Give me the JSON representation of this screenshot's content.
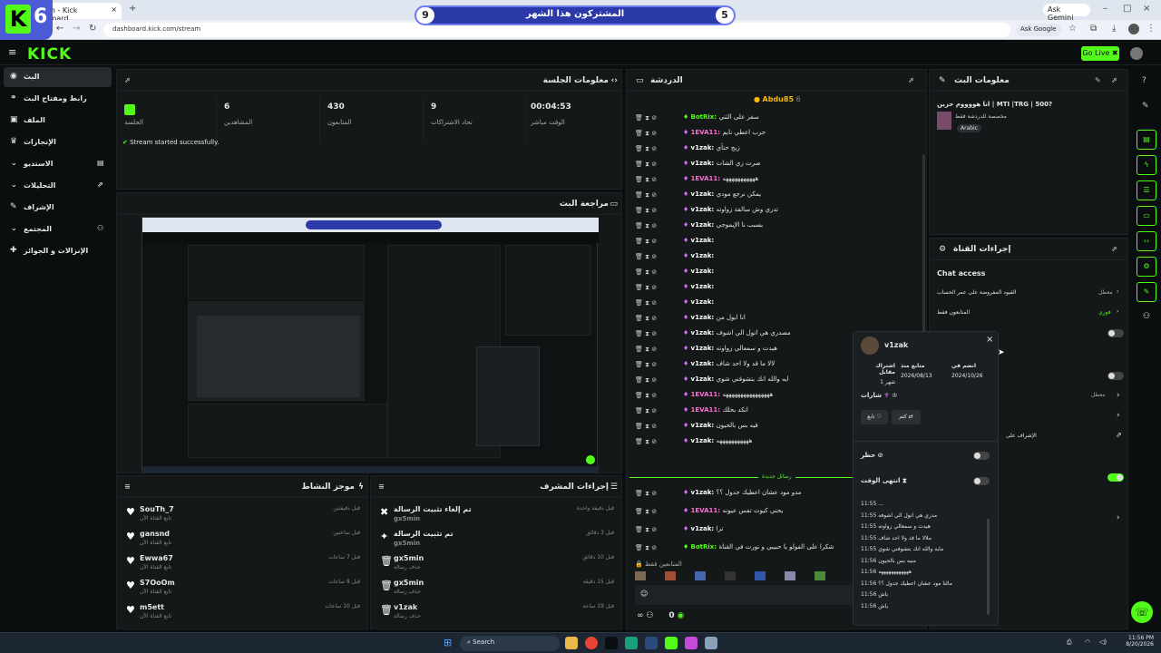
{
  "browser": {
    "tab_title": "Stream - Kick Dashboard",
    "url": "dashboard.kick.com/stream",
    "ask_gemini": "Ask Gemini",
    "ask_google": "Ask Google"
  },
  "overlay": {
    "badge_number": "6",
    "goal_title": "المشتركون هذا الشهر",
    "goal_left": "9",
    "goal_right": "5"
  },
  "header": {
    "logo": "KICK",
    "go_live": "Go Live"
  },
  "sidebar": {
    "items": [
      {
        "label": "البث"
      },
      {
        "label": "رابط ومفتاح البث"
      },
      {
        "label": "الملف"
      },
      {
        "label": "الإنجازات"
      },
      {
        "label": "الاستديو"
      },
      {
        "label": "التحليلات"
      },
      {
        "label": "الإشراف"
      },
      {
        "label": "المجتمع"
      },
      {
        "label": "الإنزالات و الجوائز"
      }
    ]
  },
  "session": {
    "title": "معلومات الجلسة",
    "live_label": "الجلسة",
    "stats": [
      {
        "value": "00:04:53",
        "label": "الوقت مباشر"
      },
      {
        "value": "9",
        "label": "تحاد الاشتراكات"
      },
      {
        "value": "430",
        "label": "المتابعون"
      },
      {
        "value": "6",
        "label": "المشاهدين"
      }
    ],
    "status": "Stream started successfully."
  },
  "preview": {
    "title": "مراجعة البث"
  },
  "activity": {
    "title": "موجز النشاط",
    "rows": [
      {
        "name": "SouTh_7",
        "sub": "تابع القناة الآن",
        "time": "قبل دقيقتين"
      },
      {
        "name": "gansnd",
        "sub": "تابع القناة الآن",
        "time": "قبل ساعتين"
      },
      {
        "name": "Ewwa67",
        "sub": "تابع القناة الآن",
        "time": "قبل 7 ساعات"
      },
      {
        "name": "S7OoOm",
        "sub": "تابع القناة الآن",
        "time": "قبل 8 ساعات"
      },
      {
        "name": "m5ett",
        "sub": "تابع القناة الآن",
        "time": "قبل 10 ساعات"
      }
    ]
  },
  "modactions": {
    "title": "إجراءات المشرف",
    "rows": [
      {
        "action": "تم إلغاء تثبيت الرسالة",
        "by": "gx5min",
        "time": "قبل دقيقة واحدة"
      },
      {
        "action": "تم تثبيت الرسالة",
        "by": "gx5min",
        "time": "قبل 3 دقائق"
      },
      {
        "action": "gx5min",
        "by": "حذف رسالة",
        "time": "قبل 10 دقائق"
      },
      {
        "action": "gx5min",
        "by": "حذف رسالة",
        "time": "قبل 15 دقيقة"
      },
      {
        "action": "v1zak",
        "by": "حذف رسالة",
        "time": "قبل 19 ساعة"
      }
    ]
  },
  "chat": {
    "title": "الدردشة",
    "pinned_user": "Abdu85",
    "pinned_count": "6",
    "lines": [
      {
        "user": "BotRix:",
        "text": "سفر على الثني",
        "color": "#53fc18"
      },
      {
        "user": "1EVA11:",
        "text": "جرب اعطي نايم",
        "color": "#ff6fd1"
      },
      {
        "user": "v1zak:",
        "text": "زيج حتأي",
        "color": "#ffffff"
      },
      {
        "user": "v1zak:",
        "text": "صرت زي الشات",
        "color": "#ffffff"
      },
      {
        "user": "1EVA11:",
        "text": "هههههههههههه",
        "color": "#ff6fd1"
      },
      {
        "user": "v1zak:",
        "text": "يمكن نرجع مودي",
        "color": "#ffffff"
      },
      {
        "user": "v1zak:",
        "text": "تدري وش سالفة زواوته",
        "color": "#ffffff"
      },
      {
        "user": "v1zak:",
        "text": "بسبب نا الإيموجي",
        "color": "#ffffff"
      },
      {
        "user": "v1zak:",
        "text": "",
        "color": "#ffffff"
      },
      {
        "user": "v1zak:",
        "text": "",
        "color": "#ffffff"
      },
      {
        "user": "v1zak:",
        "text": "",
        "color": "#ffffff"
      },
      {
        "user": "v1zak:",
        "text": "",
        "color": "#ffffff"
      },
      {
        "user": "v1zak:",
        "text": "",
        "color": "#ffffff"
      },
      {
        "user": "v1zak:",
        "text": "انا ابول من",
        "color": "#ffffff"
      },
      {
        "user": "v1zak:",
        "text": "مصدري هي اتول الي اشوف",
        "color": "#ffffff"
      },
      {
        "user": "v1zak:",
        "text": "هيدت و سمعالي زواوته",
        "color": "#ffffff"
      },
      {
        "user": "v1zak:",
        "text": "لالا ما قد ولا احد شاف",
        "color": "#ffffff"
      },
      {
        "user": "v1zak:",
        "text": "ايه والله انك بتشوفني شوي",
        "color": "#ffffff"
      },
      {
        "user": "1EVA11:",
        "text": "ههههههههههههههههه",
        "color": "#ff6fd1"
      },
      {
        "user": "1EVA11:",
        "text": "انكد بحلك",
        "color": "#ff6fd1"
      },
      {
        "user": "v1zak:",
        "text": "فيه بس بالحيون",
        "color": "#ffffff"
      },
      {
        "user": "v1zak:",
        "text": "هههههههههههه",
        "color": "#ffffff"
      }
    ],
    "new_messages": "رسائل جديدة",
    "lines2": [
      {
        "user": "v1zak:",
        "text": "مدو مود عشان اعطيك جدول ؟؟",
        "color": "#ffffff"
      },
      {
        "user": "1EVA11:",
        "text": "يحني كيوت تفس عيونه",
        "color": "#ff6fd1"
      },
      {
        "user": "v1zak:",
        "text": "ترا",
        "color": "#ffffff"
      },
      {
        "user": "BotRix:",
        "text": "شكرا على الفولو يا حبيبي و نورت في القناة",
        "color": "#53fc18"
      }
    ],
    "followers_only": "المتابعين فقط",
    "footer_count": "0"
  },
  "streaminfo": {
    "title": "معلومات البث",
    "stream_title": "انا هووووم حزين | MTI |TRG | 500?",
    "subtitle": "مخصصة للدردشة فقط",
    "language": "Arabic"
  },
  "channelsettings": {
    "title": "إجراءات القناة",
    "chat_access": "Chat access",
    "rows": [
      {
        "label": "القيود المفروضة على عمر الحساب",
        "value": "معطل"
      },
      {
        "label": "المتابعون فقط",
        "value": "فوري"
      }
    ],
    "mod_label": "الإشراف على",
    "disabled": "معطل"
  },
  "usercard": {
    "username": "v1zak",
    "joined_label": "انضم في",
    "joined_value": "2024/10/26",
    "follow_label": "متابع منذ",
    "follow_value": "2026/08/13",
    "sub_label": "اشتراك مقابل",
    "sub_value": "1 شهر",
    "badges_label": "شارات",
    "follow_btn": "تابع",
    "mute_btn": "كتم",
    "ban_label": "حظر",
    "timeout_label": "انتهى الوقت",
    "history": [
      {
        "time": "11:55",
        "text": "..."
      },
      {
        "time": "11:55",
        "text": "مدري هي اتول الي اشوفه"
      },
      {
        "time": "11:55",
        "text": "هيدت و سمعالي زواوته"
      },
      {
        "time": "11:55",
        "text": "ملالا ما قد ولا احد شاف"
      },
      {
        "time": "11:55",
        "text": "مايه والله انك بتشوفني شوي"
      },
      {
        "time": "11:56",
        "text": "منيه بس بالحيون"
      },
      {
        "time": "11:56",
        "text": "ههههههههههههه"
      },
      {
        "time": "11:56",
        "text": "مالتا مود عشان اعطيك جدول ؟؟"
      },
      {
        "time": "11:56",
        "text": "ياش"
      },
      {
        "time": "11:56",
        "text": "ياش"
      }
    ]
  },
  "taskbar": {
    "search": "Search",
    "clock_time": "11:56 PM",
    "clock_date": "8/20/2026"
  }
}
